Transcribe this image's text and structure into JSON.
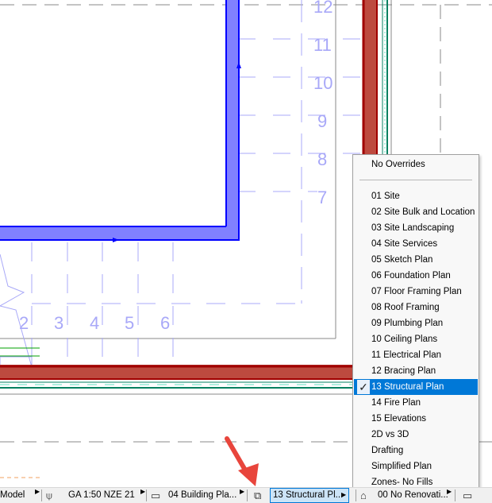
{
  "drawing": {
    "grid_numbers_vertical": [
      "12",
      "11",
      "10",
      "9",
      "8",
      "7"
    ],
    "grid_numbers_horizontal": [
      "2",
      "3",
      "4",
      "5",
      "6"
    ],
    "colors": {
      "wall_blue": "#8080ff",
      "wall_red": "#bd4a3f",
      "grid": "#a8a8f8",
      "arrow": "#e8453c"
    }
  },
  "menu": {
    "no_overrides": "No Overrides",
    "items": [
      "01 Site",
      "02 Site Bulk and Location",
      "03 Site Landscaping",
      "04 Site Services",
      "05 Sketch Plan",
      "06 Foundation Plan",
      "07 Floor Framing Plan",
      "08 Roof Framing",
      "09 Plumbing Plan",
      "10 Ceiling Plans",
      "11 Electrical Plan",
      "12 Bracing Plan",
      "13 Structural Plan",
      "14 Fire Plan",
      "15 Elevations",
      "2D vs 3D",
      "Drafting",
      "Simplified Plan",
      "Zones- No Fills"
    ],
    "selected": "13 Structural Plan",
    "check_icon": "✓",
    "accent": "#0078d7"
  },
  "status_bar": {
    "model_label": "Model",
    "pen_set": "GA 1:50 NZE 21",
    "model_view": "04 Building Pla...",
    "override": "13 Structural Pl...",
    "renovation": "00 No Renovati..."
  }
}
